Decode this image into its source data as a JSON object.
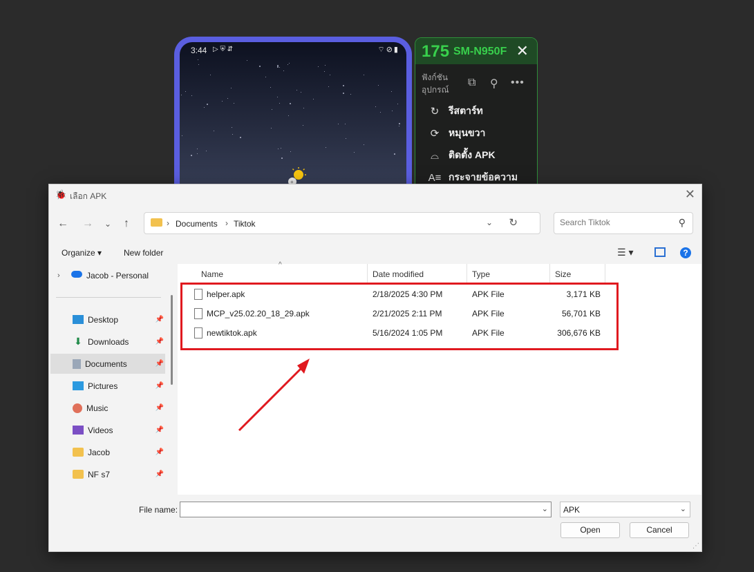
{
  "phone": {
    "time": "3:44",
    "status_icons": "▷ ⛨ ⇵",
    "status_right": "⌔⊘▮"
  },
  "panel": {
    "number": "175",
    "model": "SM-N950F",
    "function_label": "ฟังก์ชันอุปกรณ์",
    "items": [
      {
        "label": "รีสตาร์ท",
        "icon": "restart-icon"
      },
      {
        "label": "หมุนขวา",
        "icon": "rotate-icon"
      },
      {
        "label": "ติดตั้ง APK",
        "icon": "android-icon"
      },
      {
        "label": "กระจายข้อความ",
        "icon": "text-broadcast-icon"
      }
    ]
  },
  "dialog": {
    "title": "เลือก APK",
    "address": {
      "crumb1": "Documents",
      "crumb2": "Tiktok"
    },
    "search_placeholder": "Search Tiktok",
    "toolbar": {
      "organize": "Organize ▾",
      "new_folder": "New folder"
    },
    "nav": [
      {
        "label": "Jacob - Personal",
        "icon": "onedrive-icon",
        "pinned": false
      },
      {
        "label": "Desktop",
        "icon": "desktop-icon",
        "pinned": true
      },
      {
        "label": "Downloads",
        "icon": "downloads-icon",
        "pinned": true
      },
      {
        "label": "Documents",
        "icon": "documents-icon",
        "pinned": true,
        "selected": true
      },
      {
        "label": "Pictures",
        "icon": "pictures-icon",
        "pinned": true
      },
      {
        "label": "Music",
        "icon": "music-icon",
        "pinned": true
      },
      {
        "label": "Videos",
        "icon": "videos-icon",
        "pinned": true
      },
      {
        "label": "Jacob",
        "icon": "folder-icon",
        "pinned": true
      },
      {
        "label": "NF s7",
        "icon": "folder-icon",
        "pinned": true
      }
    ],
    "columns": {
      "name": "Name",
      "date": "Date modified",
      "type": "Type",
      "size": "Size"
    },
    "files": [
      {
        "name": "helper.apk",
        "date": "2/18/2025 4:30 PM",
        "type": "APK File",
        "size": "3,171 KB"
      },
      {
        "name": "MCP_v25.02.20_18_29.apk",
        "date": "2/21/2025 2:11 PM",
        "type": "APK File",
        "size": "56,701 KB"
      },
      {
        "name": "newtiktok.apk",
        "date": "5/16/2024 1:05 PM",
        "type": "APK File",
        "size": "306,676 KB"
      }
    ],
    "file_name_label": "File name:",
    "file_name_value": "",
    "file_type": "APK",
    "open_label": "Open",
    "cancel_label": "Cancel"
  },
  "colors": {
    "highlight": "#e0191f",
    "panel_green": "#38d04c",
    "phone_frame": "#5a5ee0"
  }
}
